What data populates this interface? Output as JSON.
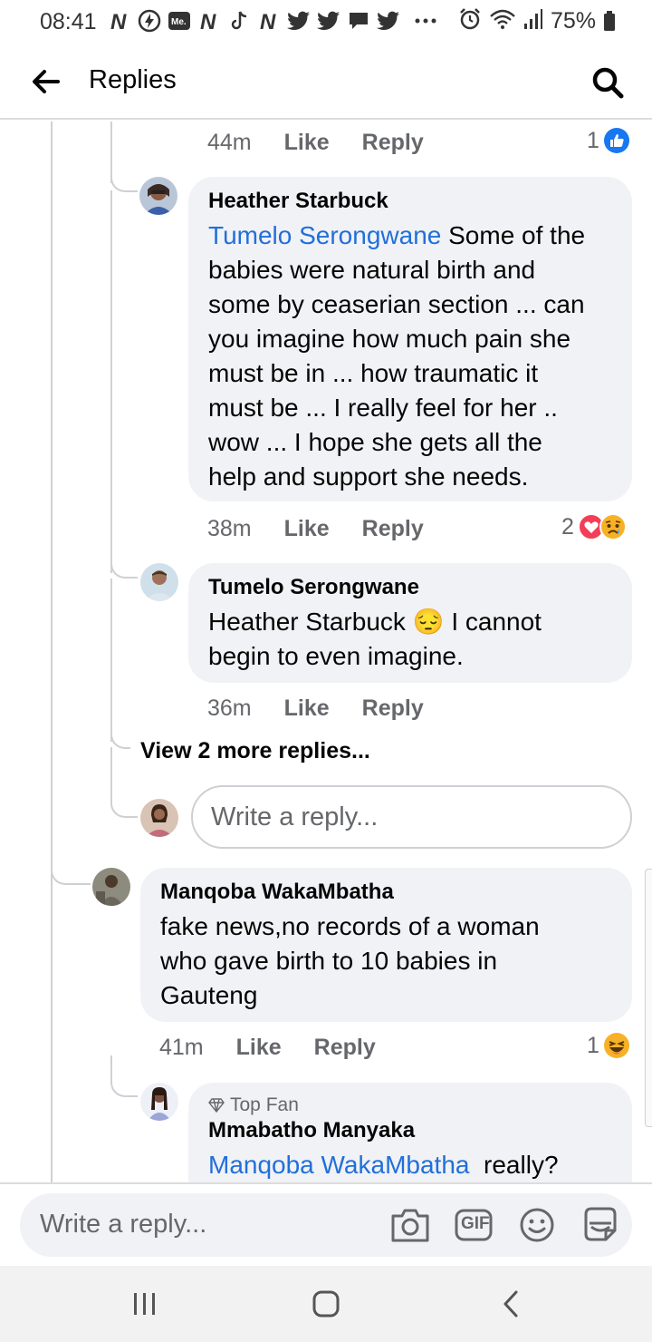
{
  "status_bar": {
    "time": "08:41",
    "battery": "75%",
    "notification_icons": [
      "netflix-n-icon",
      "messenger-bolt-icon",
      "me-icon",
      "netflix-n-icon",
      "tiktok-icon",
      "netflix-n-icon",
      "twitter-icon",
      "twitter-icon",
      "chat-icon",
      "twitter-icon",
      "more-dots-icon"
    ],
    "system_icons": [
      "alarm-icon",
      "wifi-icon",
      "signal-icon",
      "battery-icon"
    ]
  },
  "app_bar": {
    "title": "Replies",
    "back_icon": "arrow-left-icon",
    "search_icon": "search-icon"
  },
  "thread": {
    "top_meta": {
      "time": "44m",
      "like": "Like",
      "reply": "Reply",
      "reaction_count": "1",
      "reactions": [
        "like-reaction-icon"
      ]
    },
    "replies": [
      {
        "author": "Heather Starbuck",
        "mention": "Tumelo Serongwane",
        "text_lines": [
          " Some of the",
          "babies were natural birth and",
          "some by ceaserian section ... can",
          "you  imagine how much pain she",
          "must be in ... how traumatic it",
          "must be ... I really feel for her ..",
          "wow ... I hope she gets all the",
          "help and support she  needs."
        ],
        "time": "38m",
        "like": "Like",
        "reply": "Reply",
        "reaction_count": "2",
        "reactions": [
          "love-reaction-icon",
          "sad-reaction-icon"
        ]
      },
      {
        "author": "Tumelo Serongwane",
        "mention": "Heather Starbuck",
        "emoji": "😔",
        "text_line1": " I cannot",
        "text_line2": "begin to even imagine.",
        "time": "36m",
        "like": "Like",
        "reply": "Reply"
      }
    ],
    "view_more": "View 2 more replies...",
    "inline_reply_placeholder": "Write a reply...",
    "comment": {
      "author": "Manqoba WakaMbatha",
      "text_lines": [
        "fake news,no records of a woman",
        "who gave birth to 10 babies in",
        "Gauteng"
      ],
      "time": "41m",
      "like": "Like",
      "reply": "Reply",
      "reaction_count": "1",
      "reactions": [
        "haha-reaction-icon"
      ]
    },
    "last_reply": {
      "badge": "Top Fan",
      "author": "Mmabatho Manyaka",
      "mention": "Manqoba WakaMbatha",
      "text": "  really?"
    }
  },
  "composer": {
    "placeholder": "Write a reply...",
    "icons": [
      "camera-icon",
      "gif-icon",
      "emoji-icon",
      "sticker-icon"
    ],
    "gif_label": "GIF"
  },
  "nav_bar": {
    "buttons": [
      "recents-icon",
      "home-icon",
      "back-chevron-icon"
    ]
  },
  "colors": {
    "mention": "#216fdb",
    "bubble": "#f0f2f5",
    "meta_text": "#65676b",
    "like_blue": "#1877f2",
    "love_red": "#f33e58",
    "emoji_yellow": "#f7b125"
  }
}
